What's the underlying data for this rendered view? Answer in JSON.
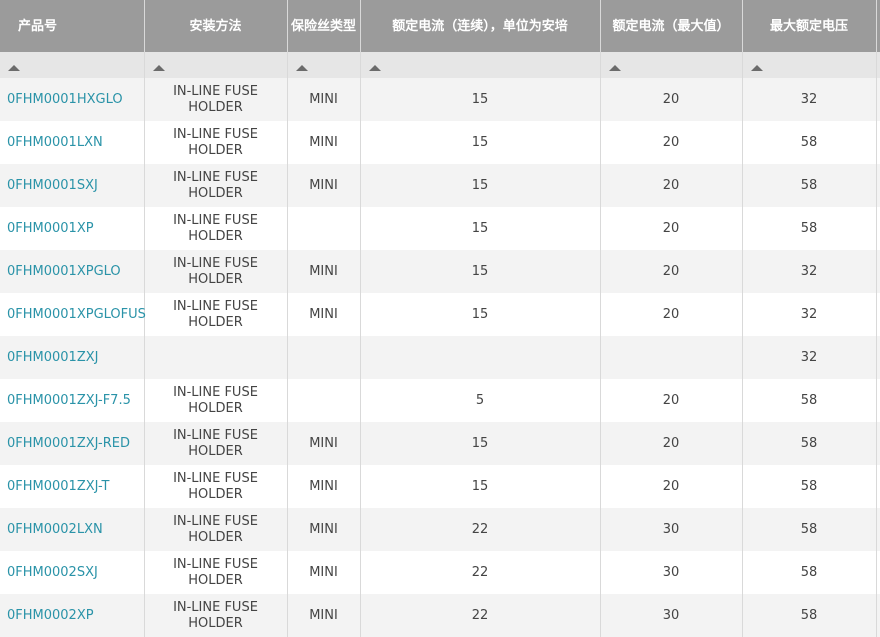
{
  "columns": [
    "产品号",
    "安装方法",
    "保险丝类型",
    "额定电流（连续），单位为安培",
    "额定电流（最大值）",
    "最大额定电压"
  ],
  "sort_icon": "triangle-up-icon",
  "rows": [
    {
      "part": "0FHM0001HXGLO",
      "mount": "IN-LINE FUSE HOLDER",
      "type": "MINI",
      "cont": "15",
      "max": "20",
      "volt": "32"
    },
    {
      "part": "0FHM0001LXN",
      "mount": "IN-LINE FUSE HOLDER",
      "type": "MINI",
      "cont": "15",
      "max": "20",
      "volt": "58"
    },
    {
      "part": "0FHM0001SXJ",
      "mount": "IN-LINE FUSE HOLDER",
      "type": "MINI",
      "cont": "15",
      "max": "20",
      "volt": "58"
    },
    {
      "part": "0FHM0001XP",
      "mount": "IN-LINE FUSE HOLDER",
      "type": "",
      "cont": "15",
      "max": "20",
      "volt": "58"
    },
    {
      "part": "0FHM0001XPGLO",
      "mount": "IN-LINE FUSE HOLDER",
      "type": "MINI",
      "cont": "15",
      "max": "20",
      "volt": "32"
    },
    {
      "part": "0FHM0001XPGLOFUS",
      "mount": "IN-LINE FUSE HOLDER",
      "type": "MINI",
      "cont": "15",
      "max": "20",
      "volt": "32"
    },
    {
      "part": "0FHM0001ZXJ",
      "mount": "",
      "type": "",
      "cont": "",
      "max": "",
      "volt": "32"
    },
    {
      "part": "0FHM0001ZXJ-F7.5",
      "mount": "IN-LINE FUSE HOLDER",
      "type": "",
      "cont": "5",
      "max": "20",
      "volt": "58"
    },
    {
      "part": "0FHM0001ZXJ-RED",
      "mount": "IN-LINE FUSE HOLDER",
      "type": "MINI",
      "cont": "15",
      "max": "20",
      "volt": "58"
    },
    {
      "part": "0FHM0001ZXJ-T",
      "mount": "IN-LINE FUSE HOLDER",
      "type": "MINI",
      "cont": "15",
      "max": "20",
      "volt": "58"
    },
    {
      "part": "0FHM0002LXN",
      "mount": "IN-LINE FUSE HOLDER",
      "type": "MINI",
      "cont": "22",
      "max": "30",
      "volt": "58"
    },
    {
      "part": "0FHM0002SXJ",
      "mount": "IN-LINE FUSE HOLDER",
      "type": "MINI",
      "cont": "22",
      "max": "30",
      "volt": "58"
    },
    {
      "part": "0FHM0002XP",
      "mount": "IN-LINE FUSE HOLDER",
      "type": "MINI",
      "cont": "22",
      "max": "30",
      "volt": "58"
    }
  ]
}
